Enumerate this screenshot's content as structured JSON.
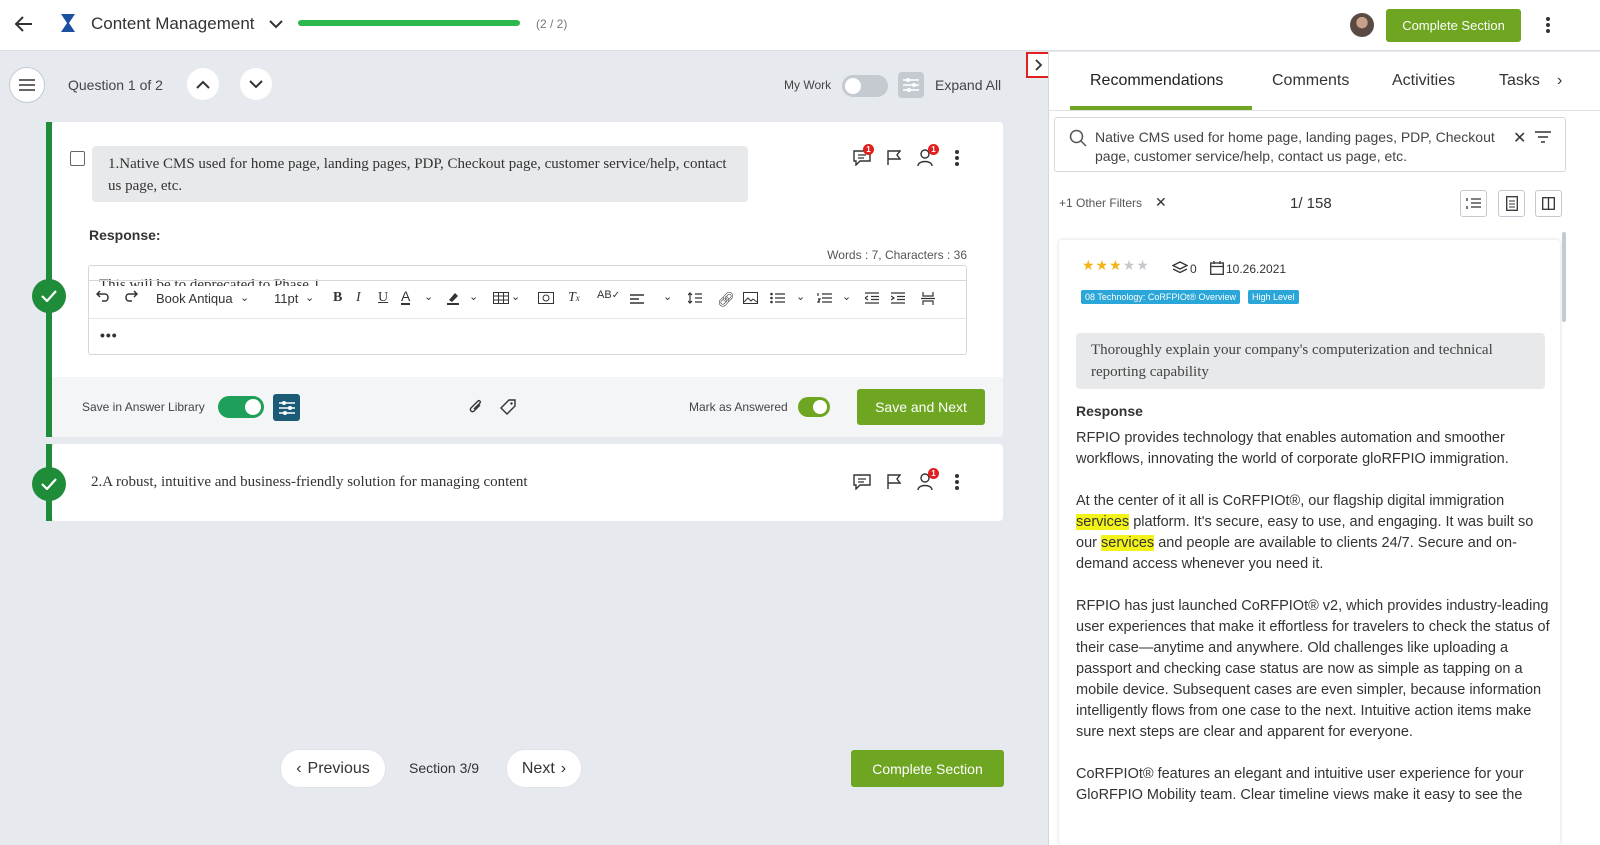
{
  "header": {
    "title": "Content Management",
    "progress_label": "(2 / 2)",
    "progress_fraction": 1.0,
    "complete_section_label": "Complete Section"
  },
  "question_nav": {
    "label": "Question 1 of 2",
    "my_work_label": "My Work",
    "expand_all_label": "Expand All"
  },
  "questions": [
    {
      "text": "1.Native CMS used for home page, landing pages, PDP, Checkout page, customer service/help, contact us page, etc.",
      "response_label": "Response:",
      "word_count": "Words : 7, Characters : 36",
      "editor_partial_text": "This will be to deprecated to Phase 1",
      "comment_badge": "1",
      "assign_badge": "1"
    },
    {
      "text": "2.A robust, intuitive and business-friendly solution for managing content",
      "assign_badge": "1"
    }
  ],
  "editor": {
    "font": "Book Antiqua",
    "size": "11pt",
    "more": "•••"
  },
  "footer_q1": {
    "save_library_label": "Save in Answer Library",
    "mark_answered_label": "Mark as Answered",
    "save_next_label": "Save and Next"
  },
  "bottom_nav": {
    "previous": "Previous",
    "section": "Section 3/9",
    "next": "Next",
    "complete_section": "Complete Section"
  },
  "right_panel": {
    "tabs": [
      "Recommendations",
      "Comments",
      "Activities",
      "Tasks"
    ],
    "search_value": "Native CMS used for home page, landing pages, PDP, Checkout page, customer service/help, contact us page, etc.",
    "other_filters": "+1 Other Filters",
    "count": "1/ 158",
    "card": {
      "rating": 3,
      "rating_max": 5,
      "layers_count": "0",
      "date": "10.26.2021",
      "tags": [
        "08 Technology: CoRFPIOt® Overview",
        "High Level"
      ],
      "question": "Thoroughly explain your company's computerization and technical reporting capability",
      "response_label": "Response",
      "paragraphs": [
        "RFPIO provides technology that enables automation and smoother workflows, innovating the world of corporate gloRFPIO immigration.",
        "RFPIO has just launched CoRFPIOt® v2, which provides industry-leading user experiences that make it effortless for travelers to check the status of their case—anytime and anywhere. Old challenges like uploading a passport and checking case status are now as simple as tapping on a mobile device. Subsequent cases are even simpler, because information intelligently flows from one case to the next. Intuitive action items make sure next steps are clear and apparent for everyone.",
        "CoRFPIOt® features an elegant and intuitive user experience for your GloRFPIO Mobility team. Clear timeline views make it easy to see the"
      ],
      "p2_parts": {
        "a": "At the center of it all is CoRFPIOt®, our flagship digital immigration ",
        "hl1": "services",
        "b": " platform. It's secure, easy to use, and engaging. It was built so our ",
        "hl2": "services",
        "c": " and people are available to clients 24/7. Secure and on-demand access whenever you need it."
      }
    }
  },
  "colors": {
    "accent_green": "#6ea521",
    "status_green": "#1f8c3a",
    "toggle_green": "#1fa05a",
    "tag_blue": "#2aa6d8",
    "highlight": "#f3f31a"
  }
}
